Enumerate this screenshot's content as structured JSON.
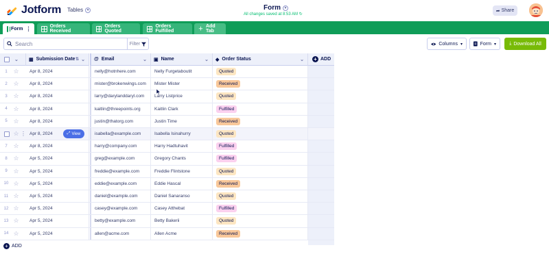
{
  "app": {
    "logo_text": "Jotform",
    "tables_label": "Tables",
    "form_title": "Form",
    "saved_status": "All changes saved at 8:53 AM",
    "share_label": "Share"
  },
  "tabs": [
    {
      "label": "Form"
    },
    {
      "label": "Orders Received"
    },
    {
      "label": "Orders Quoted"
    },
    {
      "label": "Orders Fulfilled"
    },
    {
      "label": "Add Tab"
    }
  ],
  "toolbar": {
    "search_placeholder": "Search",
    "filter_label": "Filter",
    "columns_label": "Columns",
    "form_label": "Form",
    "download_label": "Download All"
  },
  "columns": [
    "Submission Date",
    "Email",
    "Name",
    "Order Status"
  ],
  "add_column_label": "ADD",
  "view_label": "View",
  "add_row_label": "ADD",
  "colors": {
    "brand_green": "#0f9d58",
    "download_green": "#78bb07",
    "quoted": "#fde6c2",
    "received": "#f9c89a",
    "fulfilled": "#fbd1ef"
  },
  "rows": [
    {
      "num": "1",
      "date": "Apr 8, 2024",
      "email": "nelly@hotnhere.com",
      "name": "Nelly Furgetaboutit",
      "status": "Quoted"
    },
    {
      "num": "2",
      "date": "Apr 8, 2024",
      "email": "mister@brokenwings.com",
      "name": "Mister Mister",
      "status": "Received"
    },
    {
      "num": "3",
      "date": "Apr 8, 2024",
      "email": "larry@darylanddaryl.com",
      "name": "Larry Listprice",
      "status": "Quoted"
    },
    {
      "num": "4",
      "date": "Apr 8, 2024",
      "email": "kaitlin@threepoints.org",
      "name": "Kaitlin Clark",
      "status": "Fulfilled"
    },
    {
      "num": "5",
      "date": "Apr 8, 2024",
      "email": "justin@thatorg.com",
      "name": "Justin Time",
      "status": "Received"
    },
    {
      "num": "6",
      "date": "Apr 8, 2024",
      "email": "isabella@example.com",
      "name": "Isabella Isinahurry",
      "status": "Quoted"
    },
    {
      "num": "7",
      "date": "Apr 8, 2024",
      "email": "harry@company.com",
      "name": "Harry Hadtuhavit",
      "status": "Fulfilled"
    },
    {
      "num": "8",
      "date": "Apr 5, 2024",
      "email": "greg@example.com",
      "name": "Gregory Chants",
      "status": "Fulfilled"
    },
    {
      "num": "9",
      "date": "Apr 5, 2024",
      "email": "freddie@example.com",
      "name": "Freddie Flintstone",
      "status": "Quoted"
    },
    {
      "num": "10",
      "date": "Apr 5, 2024",
      "email": "eddie@example.com",
      "name": "Eddie Hascal",
      "status": "Received"
    },
    {
      "num": "11",
      "date": "Apr 5, 2024",
      "email": "daniel@example.com",
      "name": "Daniel Sanaranso",
      "status": "Quoted"
    },
    {
      "num": "12",
      "date": "Apr 5, 2024",
      "email": "casey@example.com",
      "name": "Casey Atthebat",
      "status": "Fulfilled"
    },
    {
      "num": "13",
      "date": "Apr 5, 2024",
      "email": "betty@example.com",
      "name": "Betty Bakerii",
      "status": "Quoted"
    },
    {
      "num": "14",
      "date": "Apr 5, 2024",
      "email": "allen@acme.com",
      "name": "Allen Acme",
      "status": "Received"
    }
  ]
}
